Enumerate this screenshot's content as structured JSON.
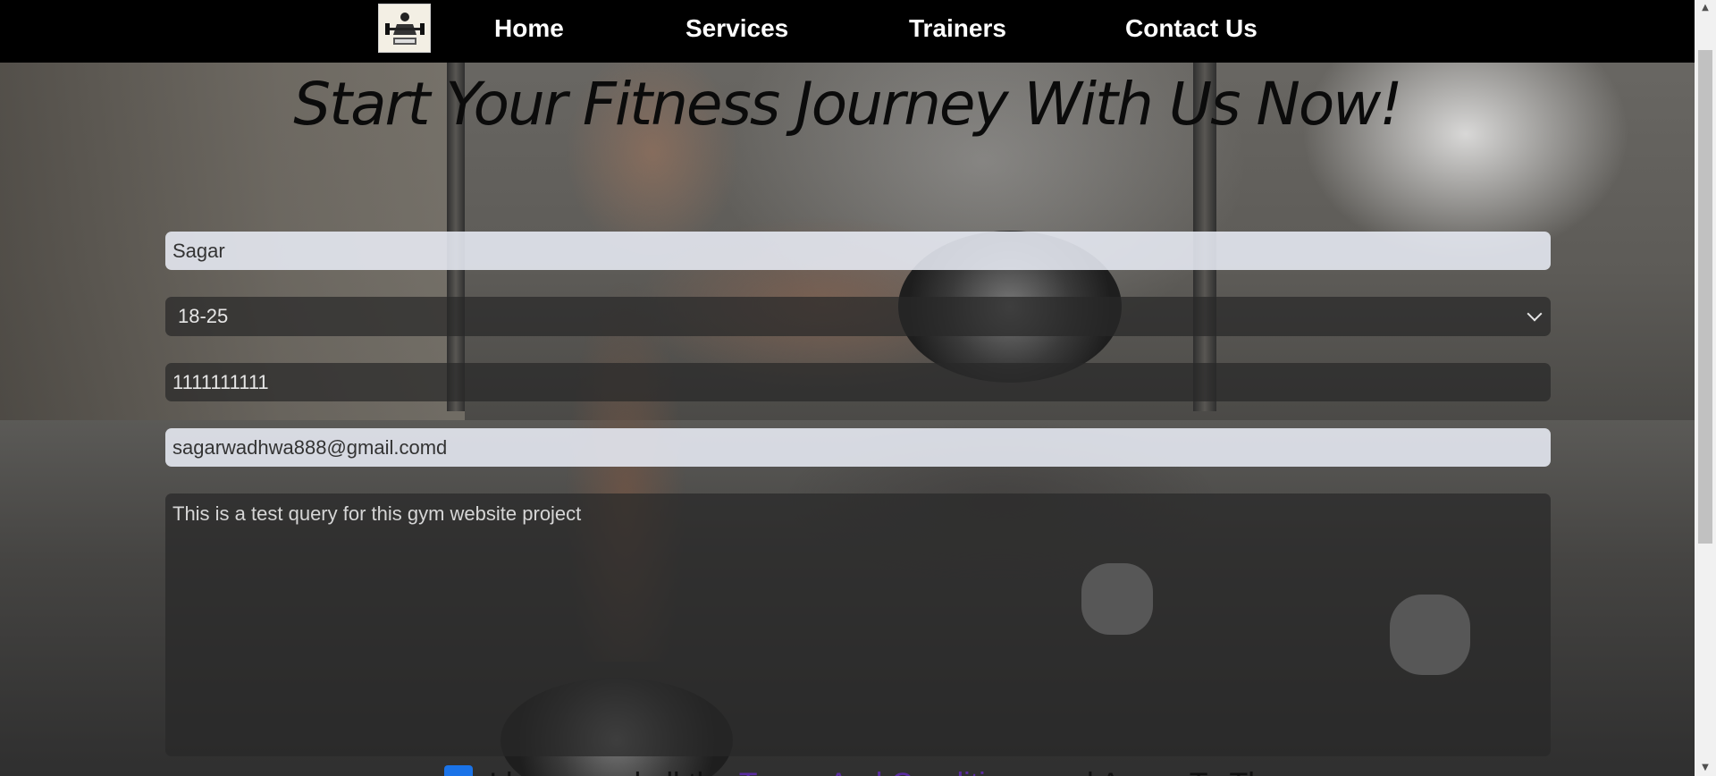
{
  "nav": {
    "logo_alt": "Gym logo",
    "links": [
      "Home",
      "Services",
      "Trainers",
      "Contact Us"
    ]
  },
  "heading": "Start Your Fitness Journey With Us Now!",
  "form": {
    "name_value": "Sagar",
    "age_value": "18-25",
    "phone_value": "1111111111",
    "email_value": "sagarwadhwa888@gmail.comd",
    "message_value": "This is a test query for this gym website project"
  },
  "terms": {
    "prefix": "I have read all the",
    "link": "Terms And Conditions",
    "suffix": "and Agree To Them"
  },
  "icons": {
    "logo": "gym-logo-icon",
    "chevron": "chevron-down-icon",
    "checkbox": "checkbox-checked-icon"
  }
}
